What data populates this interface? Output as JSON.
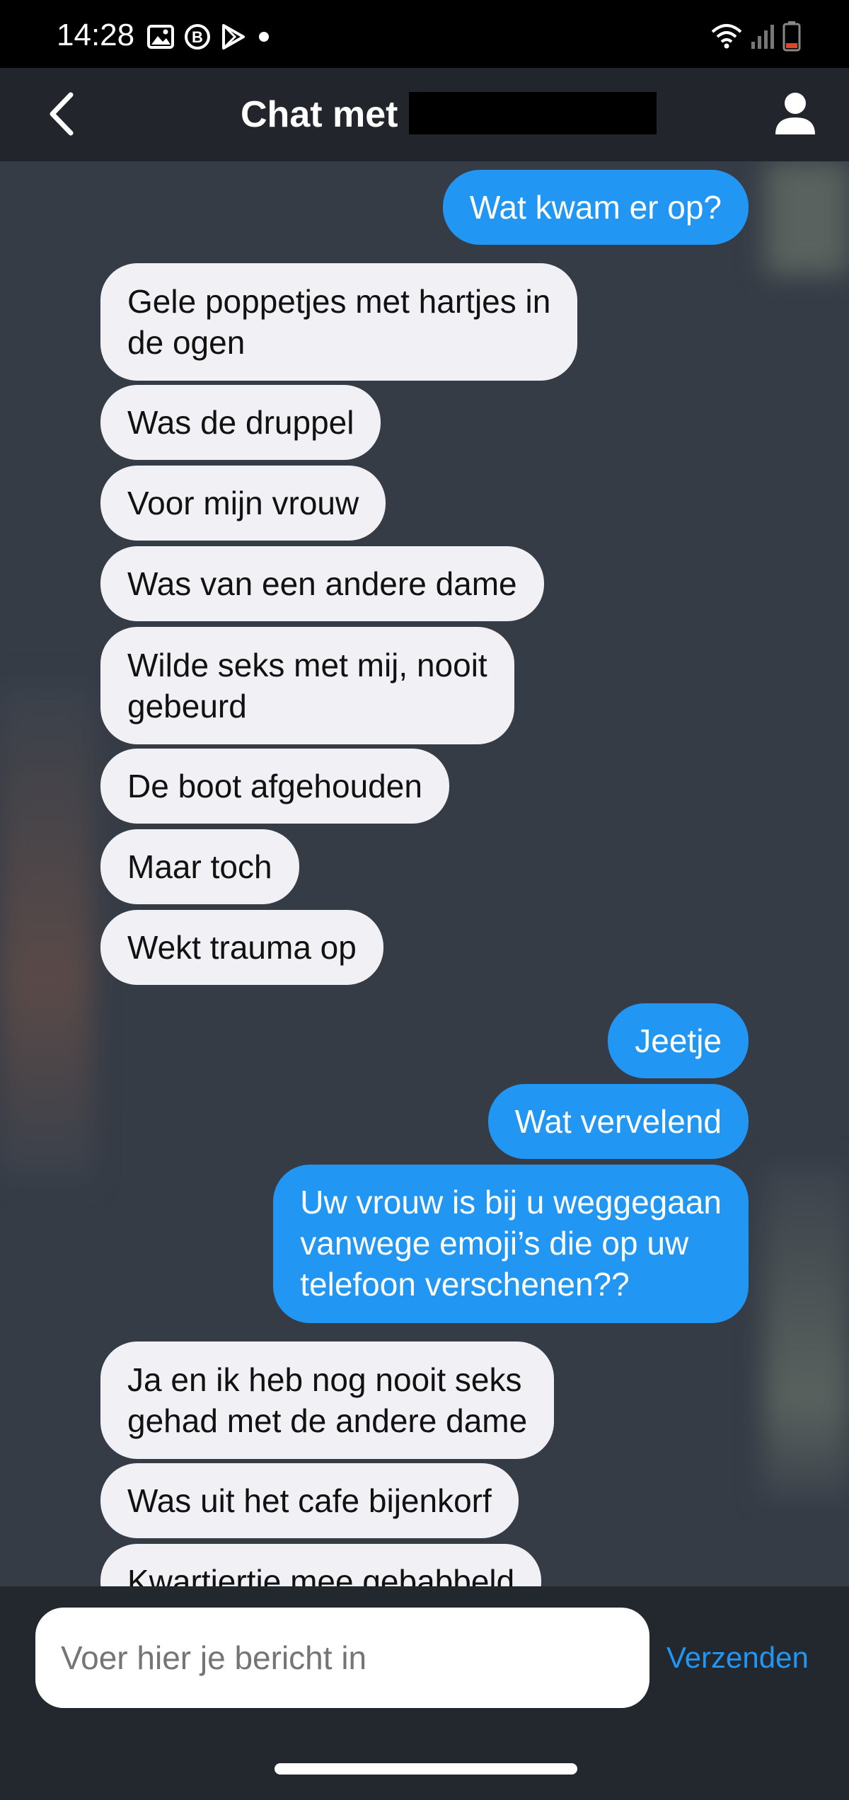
{
  "status_bar": {
    "time": "14:28",
    "left_icons": [
      "image-icon",
      "b-icon",
      "play-icon",
      "dot-icon"
    ],
    "right_icons": [
      "wifi-icon",
      "signal-icon",
      "battery-low-icon"
    ],
    "battery_color": "#e0452b"
  },
  "header": {
    "title": "Chat met",
    "back_icon": "chevron-left-icon",
    "profile_icon": "person-icon"
  },
  "messages": [
    {
      "side": "out",
      "text": "Wat kwam er op?"
    },
    {
      "side": "in",
      "text": "Gele poppetjes met hartjes in\nde ogen"
    },
    {
      "side": "in",
      "text": "Was de druppel"
    },
    {
      "side": "in",
      "text": "Voor mijn vrouw"
    },
    {
      "side": "in",
      "text": "Was van een andere dame"
    },
    {
      "side": "in",
      "text": "Wilde seks met mij, nooit\ngebeurd"
    },
    {
      "side": "in",
      "text": "De boot afgehouden"
    },
    {
      "side": "in",
      "text": "Maar toch"
    },
    {
      "side": "in",
      "text": "Wekt trauma op"
    },
    {
      "side": "out",
      "text": "Jeetje"
    },
    {
      "side": "out",
      "text": "Wat vervelend"
    },
    {
      "side": "out",
      "text": "Uw vrouw is bij u weggegaan\nvanwege emoji’s die op uw\ntelefoon verschenen??"
    },
    {
      "side": "in",
      "text": "Ja en ik heb nog nooit seks\ngehad met de andere dame"
    },
    {
      "side": "in",
      "text": "Was uit het cafe bijenkorf"
    },
    {
      "side": "in",
      "text": "Kwartiertje mee gebabbeld"
    }
  ],
  "composer": {
    "placeholder": "Voer hier je bericht in",
    "send_label": "Verzenden"
  },
  "colors": {
    "outgoing_bubble": "#2196f3",
    "incoming_bubble": "#f1f0f4",
    "chat_background": "#363c46",
    "header_background": "#22262c"
  }
}
